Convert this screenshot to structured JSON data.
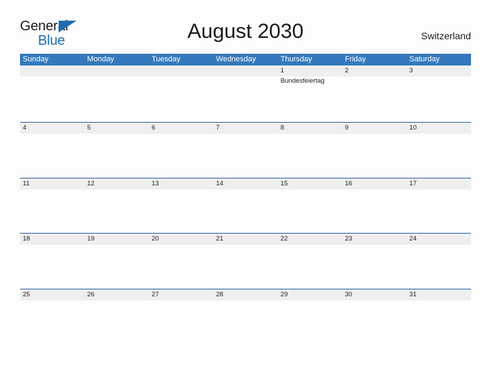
{
  "brand": {
    "name_part1": "General",
    "name_part2": "Blue",
    "triangle_icon": "triangle-right-icon",
    "accent_color": "#1f6bb0"
  },
  "header": {
    "title": "August 2030",
    "country": "Switzerland"
  },
  "theme": {
    "header_bar_color": "#3479bd",
    "date_band_color": "#efefef",
    "date_band_border_color": "#2a6099",
    "page_background": "#fdfdfd",
    "text_color": "#1b1b1b"
  },
  "calendar": {
    "month": "August",
    "year": "2030",
    "weekday_headers": [
      "Sunday",
      "Monday",
      "Tuesday",
      "Wednesday",
      "Thursday",
      "Friday",
      "Saturday"
    ],
    "weeks": [
      {
        "days": [
          {
            "date": "",
            "event": ""
          },
          {
            "date": "",
            "event": ""
          },
          {
            "date": "",
            "event": ""
          },
          {
            "date": "",
            "event": ""
          },
          {
            "date": "1",
            "event": "Bundesfeiertag"
          },
          {
            "date": "2",
            "event": ""
          },
          {
            "date": "3",
            "event": ""
          }
        ]
      },
      {
        "days": [
          {
            "date": "4",
            "event": ""
          },
          {
            "date": "5",
            "event": ""
          },
          {
            "date": "6",
            "event": ""
          },
          {
            "date": "7",
            "event": ""
          },
          {
            "date": "8",
            "event": ""
          },
          {
            "date": "9",
            "event": ""
          },
          {
            "date": "10",
            "event": ""
          }
        ]
      },
      {
        "days": [
          {
            "date": "11",
            "event": ""
          },
          {
            "date": "12",
            "event": ""
          },
          {
            "date": "13",
            "event": ""
          },
          {
            "date": "14",
            "event": ""
          },
          {
            "date": "15",
            "event": ""
          },
          {
            "date": "16",
            "event": ""
          },
          {
            "date": "17",
            "event": ""
          }
        ]
      },
      {
        "days": [
          {
            "date": "18",
            "event": ""
          },
          {
            "date": "19",
            "event": ""
          },
          {
            "date": "20",
            "event": ""
          },
          {
            "date": "21",
            "event": ""
          },
          {
            "date": "22",
            "event": ""
          },
          {
            "date": "23",
            "event": ""
          },
          {
            "date": "24",
            "event": ""
          }
        ]
      },
      {
        "days": [
          {
            "date": "25",
            "event": ""
          },
          {
            "date": "26",
            "event": ""
          },
          {
            "date": "27",
            "event": ""
          },
          {
            "date": "28",
            "event": ""
          },
          {
            "date": "29",
            "event": ""
          },
          {
            "date": "30",
            "event": ""
          },
          {
            "date": "31",
            "event": ""
          }
        ]
      }
    ]
  }
}
